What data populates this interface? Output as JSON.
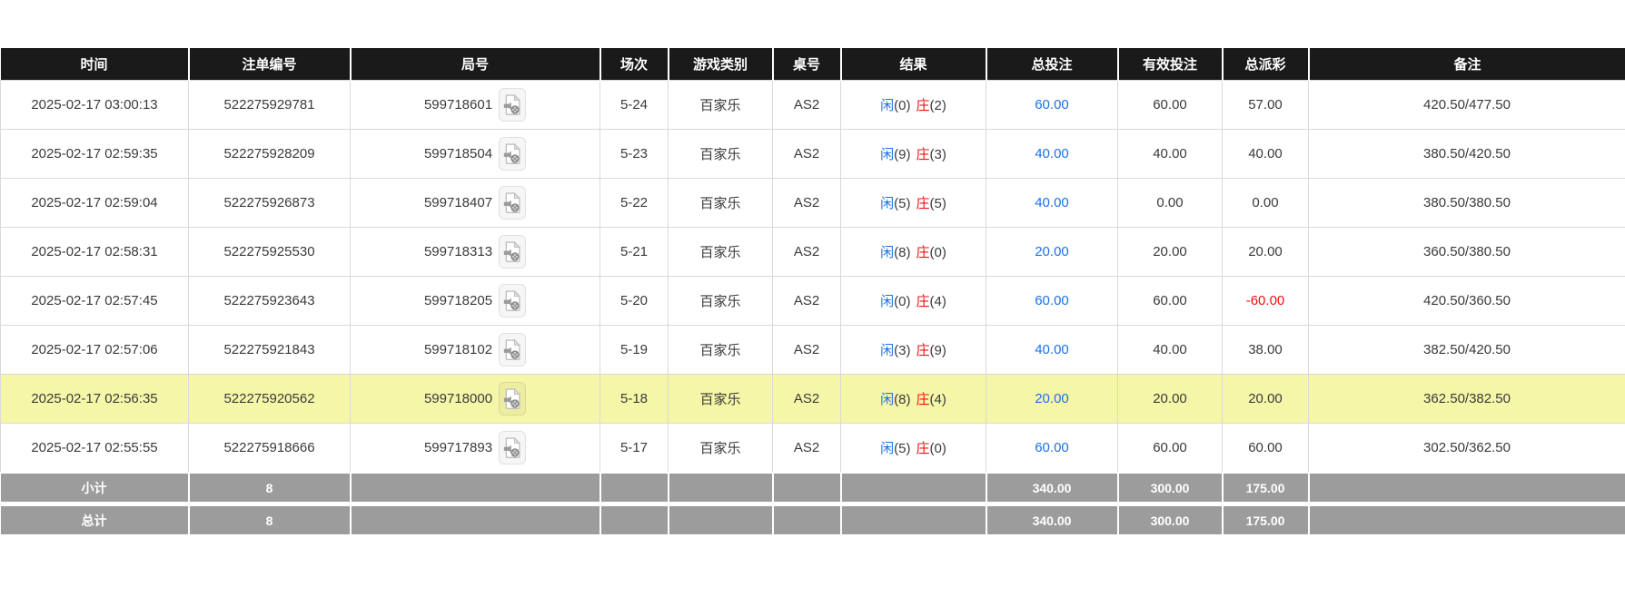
{
  "colors": {
    "header_bg": "#1a1a1a",
    "footer_bg": "#9c9c9c",
    "highlight_row": "#f6f6a8",
    "accent_blue": "#1d72e8",
    "accent_red": "#ee1111",
    "grid_line": "#d9d9d9"
  },
  "icons": {
    "round_replay": "video-file-icon"
  },
  "table": {
    "columns": [
      {
        "key": "time",
        "label": "时间"
      },
      {
        "key": "bet-id",
        "label": "注单编号"
      },
      {
        "key": "round-id",
        "label": "局号"
      },
      {
        "key": "session",
        "label": "场次"
      },
      {
        "key": "game-type",
        "label": "游戏类别"
      },
      {
        "key": "table-no",
        "label": "桌号"
      },
      {
        "key": "result",
        "label": "结果"
      },
      {
        "key": "total-bet",
        "label": "总投注"
      },
      {
        "key": "valid-bet",
        "label": "有效投注"
      },
      {
        "key": "payout",
        "label": "总派彩"
      },
      {
        "key": "remark",
        "label": "备注"
      }
    ],
    "rows": [
      {
        "time": "2025-02-17 03:00:13",
        "bet_id": "522275929781",
        "round_id": "599718601",
        "session": "5-24",
        "game_type": "百家乐",
        "table_no": "AS2",
        "result": {
          "player_label": "闲",
          "player_count": "(0)",
          "banker_label": "庄",
          "banker_count": "(2)"
        },
        "total_bet": "60.00",
        "valid_bet": "60.00",
        "payout": "57.00",
        "remark": "420.50/477.50",
        "highlighted": false
      },
      {
        "time": "2025-02-17 02:59:35",
        "bet_id": "522275928209",
        "round_id": "599718504",
        "session": "5-23",
        "game_type": "百家乐",
        "table_no": "AS2",
        "result": {
          "player_label": "闲",
          "player_count": "(9)",
          "banker_label": "庄",
          "banker_count": "(3)"
        },
        "total_bet": "40.00",
        "valid_bet": "40.00",
        "payout": "40.00",
        "remark": "380.50/420.50",
        "highlighted": false
      },
      {
        "time": "2025-02-17 02:59:04",
        "bet_id": "522275926873",
        "round_id": "599718407",
        "session": "5-22",
        "game_type": "百家乐",
        "table_no": "AS2",
        "result": {
          "player_label": "闲",
          "player_count": "(5)",
          "banker_label": "庄",
          "banker_count": "(5)"
        },
        "total_bet": "40.00",
        "valid_bet": "0.00",
        "payout": "0.00",
        "remark": "380.50/380.50",
        "highlighted": false
      },
      {
        "time": "2025-02-17 02:58:31",
        "bet_id": "522275925530",
        "round_id": "599718313",
        "session": "5-21",
        "game_type": "百家乐",
        "table_no": "AS2",
        "result": {
          "player_label": "闲",
          "player_count": "(8)",
          "banker_label": "庄",
          "banker_count": "(0)"
        },
        "total_bet": "20.00",
        "valid_bet": "20.00",
        "payout": "20.00",
        "remark": "360.50/380.50",
        "highlighted": false
      },
      {
        "time": "2025-02-17 02:57:45",
        "bet_id": "522275923643",
        "round_id": "599718205",
        "session": "5-20",
        "game_type": "百家乐",
        "table_no": "AS2",
        "result": {
          "player_label": "闲",
          "player_count": "(0)",
          "banker_label": "庄",
          "banker_count": "(4)"
        },
        "total_bet": "60.00",
        "valid_bet": "60.00",
        "payout": "-60.00",
        "remark": "420.50/360.50",
        "highlighted": false
      },
      {
        "time": "2025-02-17 02:57:06",
        "bet_id": "522275921843",
        "round_id": "599718102",
        "session": "5-19",
        "game_type": "百家乐",
        "table_no": "AS2",
        "result": {
          "player_label": "闲",
          "player_count": "(3)",
          "banker_label": "庄",
          "banker_count": "(9)"
        },
        "total_bet": "40.00",
        "valid_bet": "40.00",
        "payout": "38.00",
        "remark": "382.50/420.50",
        "highlighted": false
      },
      {
        "time": "2025-02-17 02:56:35",
        "bet_id": "522275920562",
        "round_id": "599718000",
        "session": "5-18",
        "game_type": "百家乐",
        "table_no": "AS2",
        "result": {
          "player_label": "闲",
          "player_count": "(8)",
          "banker_label": "庄",
          "banker_count": "(4)"
        },
        "total_bet": "20.00",
        "valid_bet": "20.00",
        "payout": "20.00",
        "remark": "362.50/382.50",
        "highlighted": true
      },
      {
        "time": "2025-02-17 02:55:55",
        "bet_id": "522275918666",
        "round_id": "599717893",
        "session": "5-17",
        "game_type": "百家乐",
        "table_no": "AS2",
        "result": {
          "player_label": "闲",
          "player_count": "(5)",
          "banker_label": "庄",
          "banker_count": "(0)"
        },
        "total_bet": "60.00",
        "valid_bet": "60.00",
        "payout": "60.00",
        "remark": "302.50/362.50",
        "highlighted": false
      }
    ],
    "footer_rows": [
      {
        "key": "subtotal",
        "label": "小计",
        "count": "8",
        "total_bet": "340.00",
        "valid_bet": "300.00",
        "payout": "175.00"
      },
      {
        "key": "total",
        "label": "总计",
        "count": "8",
        "total_bet": "340.00",
        "valid_bet": "300.00",
        "payout": "175.00"
      }
    ]
  }
}
